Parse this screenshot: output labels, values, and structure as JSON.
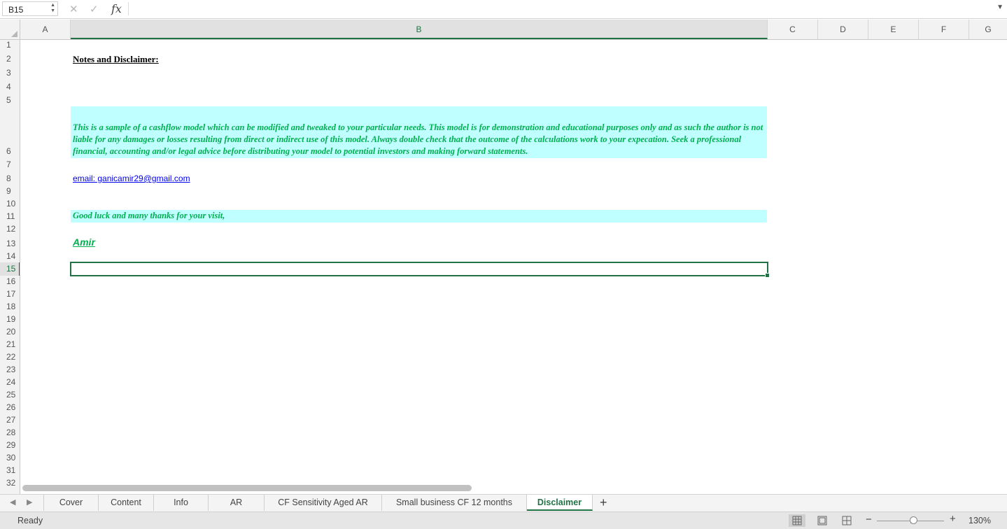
{
  "formula_bar": {
    "name_box": "B15",
    "cancel_icon": "x-icon",
    "enter_icon": "check-icon",
    "function_label": "fx",
    "formula": ""
  },
  "columns": [
    "A",
    "B",
    "C",
    "D",
    "E",
    "F",
    "G"
  ],
  "selected_column": "B",
  "rows": [
    "1",
    "2",
    "3",
    "4",
    "5",
    "6",
    "7",
    "8",
    "9",
    "10",
    "11",
    "12",
    "13",
    "14",
    "15",
    "16",
    "17",
    "18",
    "19",
    "20",
    "21",
    "22",
    "23",
    "24",
    "25",
    "26",
    "27",
    "28",
    "29",
    "30",
    "31",
    "32"
  ],
  "selected_row": "15",
  "sheet": {
    "title": "Notes and Disclaimer:",
    "disclaimer": "This is a sample of a cashflow model which can be modified and tweaked to your particular needs. This model is for demonstration and educational purposes only and as such the author is not liable for any damages or losses resulting from direct or indirect use of this model. Always double check that the outcome of the calculations work to your expecation. Seek a professional financial, accounting and/or legal advice before distributing your model to potential investors and making forward statements.",
    "email": "email: ganicamir29@gmail.com",
    "thanks": "Good luck and many thanks for your visit,",
    "signature": "Amir "
  },
  "tabs": [
    "Cover",
    "Content",
    "Info",
    "AR",
    "CF Sensitivity Aged AR",
    "Small business CF 12 months",
    "Disclaimer"
  ],
  "active_tab": "Disclaimer",
  "status": {
    "ready": "Ready",
    "zoom": "130%"
  },
  "colors": {
    "accent": "#217346",
    "highlight_fill": "#c0ffff",
    "text_green": "#00b050",
    "link": "#0000ee"
  }
}
